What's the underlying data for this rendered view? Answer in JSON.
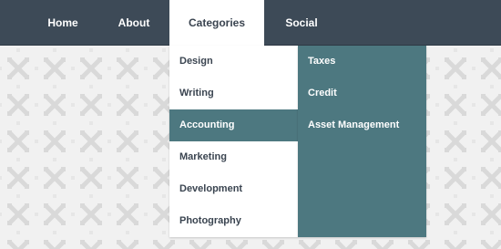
{
  "nav": {
    "items": [
      {
        "label": "Home"
      },
      {
        "label": "About"
      },
      {
        "label": "Categories"
      },
      {
        "label": "Social"
      }
    ]
  },
  "dropdown": {
    "items": [
      {
        "label": "Design"
      },
      {
        "label": "Writing"
      },
      {
        "label": "Accounting"
      },
      {
        "label": "Marketing"
      },
      {
        "label": "Development"
      },
      {
        "label": "Photography"
      }
    ]
  },
  "submenu": {
    "items": [
      {
        "label": "Taxes"
      },
      {
        "label": "Credit"
      },
      {
        "label": "Asset Management"
      }
    ]
  },
  "colors": {
    "navbar": "#3d4a57",
    "accent": "#4d7880",
    "background": "#f1f1f1"
  }
}
